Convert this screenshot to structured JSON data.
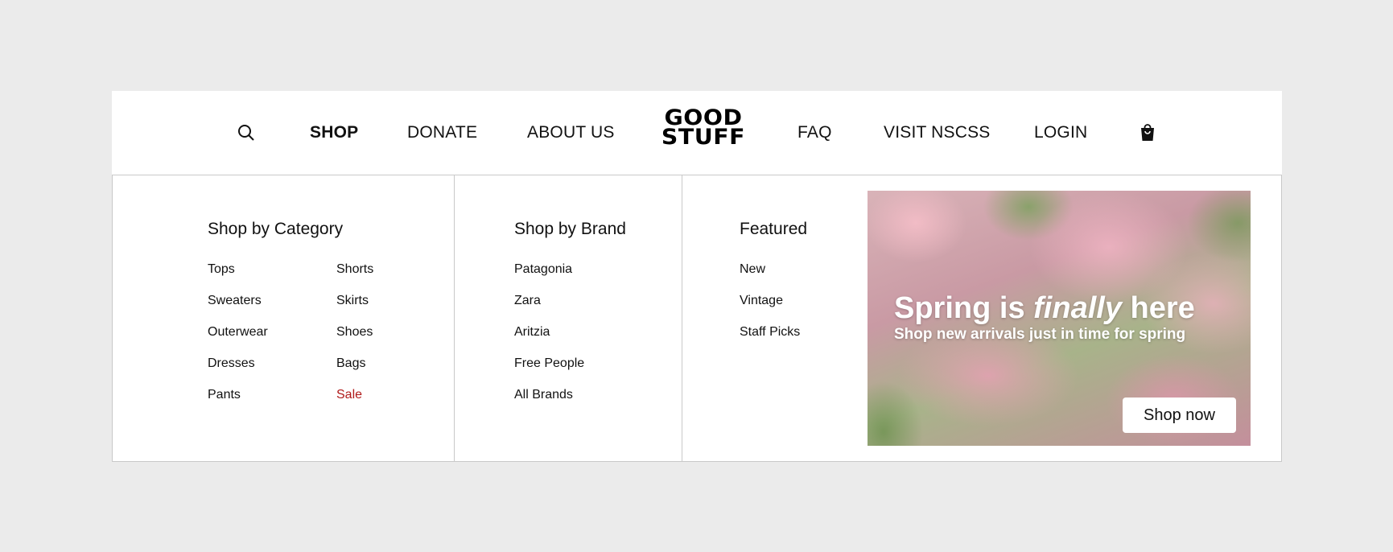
{
  "nav": {
    "search_icon": "search-icon",
    "items": [
      {
        "label": "SHOP",
        "active": true
      },
      {
        "label": "DONATE"
      },
      {
        "label": "ABOUT US"
      },
      {
        "label": "FAQ"
      },
      {
        "label": "VISIT NSCSS"
      },
      {
        "label": "LOGIN"
      }
    ],
    "logo_line1": "GOOD",
    "logo_line2": "STUFF",
    "cart_icon": "shopping-bag-icon"
  },
  "menu": {
    "category": {
      "title": "Shop by Category",
      "col1": [
        "Tops",
        "Sweaters",
        "Outerwear",
        "Dresses",
        "Pants"
      ],
      "col2": [
        "Shorts",
        "Skirts",
        "Shoes",
        "Bags",
        "Sale"
      ]
    },
    "brand": {
      "title": "Shop by Brand",
      "items": [
        "Patagonia",
        "Zara",
        "Aritzia",
        "Free People",
        "All Brands"
      ]
    },
    "featured": {
      "title": "Featured",
      "items": [
        "New",
        "Vintage",
        "Staff Picks"
      ]
    },
    "promo": {
      "title_part1": "Spring is ",
      "title_emph": "finally",
      "title_part2": " here",
      "subtitle": "Shop new arrivals just in time for spring",
      "button": "Shop now"
    }
  },
  "colors": {
    "background": "#ebebeb",
    "panel": "#ffffff",
    "sale": "#b01a1a",
    "text": "#111111"
  }
}
